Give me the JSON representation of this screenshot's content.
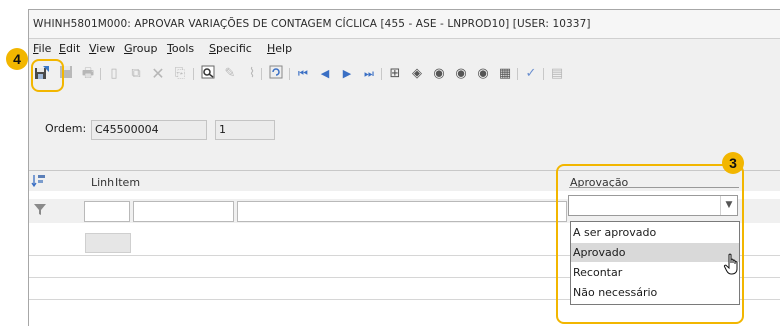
{
  "window": {
    "title": "WHINH5801M000: APROVAR VARIAÇÕES DE CONTAGEM CÍCLICA [455 - ASE  - LNPROD10] [USER: 10337]"
  },
  "menu": [
    {
      "first": "F",
      "rest": "ile"
    },
    {
      "first": "E",
      "rest": "dit"
    },
    {
      "first": "V",
      "rest": "iew"
    },
    {
      "first": "G",
      "rest": "roup"
    },
    {
      "first": "T",
      "rest": "ools"
    },
    {
      "first": "S",
      "rest": "pecific"
    },
    {
      "first": "H",
      "rest": "elp"
    }
  ],
  "form": {
    "ordem_label": "Ordem:",
    "ordem_value": "C45500004",
    "ordem_seq": "1"
  },
  "grid": {
    "columns": [
      "Linh",
      "Item",
      "Aprovação"
    ]
  },
  "dropdown": {
    "options": [
      "A ser aprovado",
      "Aprovado",
      "Recontar",
      "Não necessário"
    ],
    "highlighted": "Aprovado"
  },
  "callouts": {
    "toolbar_step": "4",
    "approval_step": "3"
  },
  "colors": {
    "callout": "#f2b600",
    "selected_option": "#d9d9d9"
  },
  "icons": {
    "save_and_close": "save-close-icon",
    "filter": "filter-icon",
    "cursor": "hand-pointer-icon"
  }
}
